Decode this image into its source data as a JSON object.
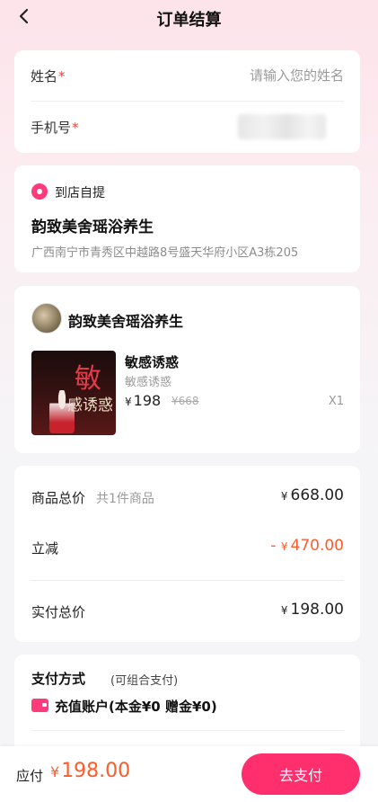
{
  "header": {
    "title": "订单结算"
  },
  "form": {
    "name_label": "姓名",
    "name_placeholder": "请输入您的姓名",
    "phone_label": "手机号",
    "required_mark": "*"
  },
  "pickup": {
    "method": "到店自提",
    "store_name": "韵致美舍瑶浴养生",
    "address": "广西南宁市青秀区中越路8号盛天华府小区A3栋205"
  },
  "order": {
    "shop_name": "韵致美舍瑶浴养生",
    "product": {
      "image_big_text": "敏",
      "image_small_text": "感诱惑",
      "title": "敏感诱惑",
      "subtitle": "敏感诱惑",
      "currency": "¥",
      "price": "198",
      "original_price": "¥668",
      "quantity": "X1"
    }
  },
  "summary": {
    "total_label": "商品总价",
    "total_count": "共1件商品",
    "total_value": "668.00",
    "discount_label": "立减",
    "discount_prefix": "- ",
    "discount_value": "470.00",
    "paid_label": "实付总价",
    "paid_value": "198.00",
    "currency": "¥"
  },
  "payment": {
    "title": "支付方式",
    "note": "(可组合支付)",
    "method": "充值账户(本金¥0 赠金¥0)"
  },
  "footer": {
    "due_label": "应付",
    "currency": "¥",
    "due_amount": "198.00",
    "pay_button": "去支付"
  },
  "colors": {
    "accent": "#ff2e6d",
    "price_red": "#ff5a2c",
    "pink_icon": "#ff3b7b"
  }
}
